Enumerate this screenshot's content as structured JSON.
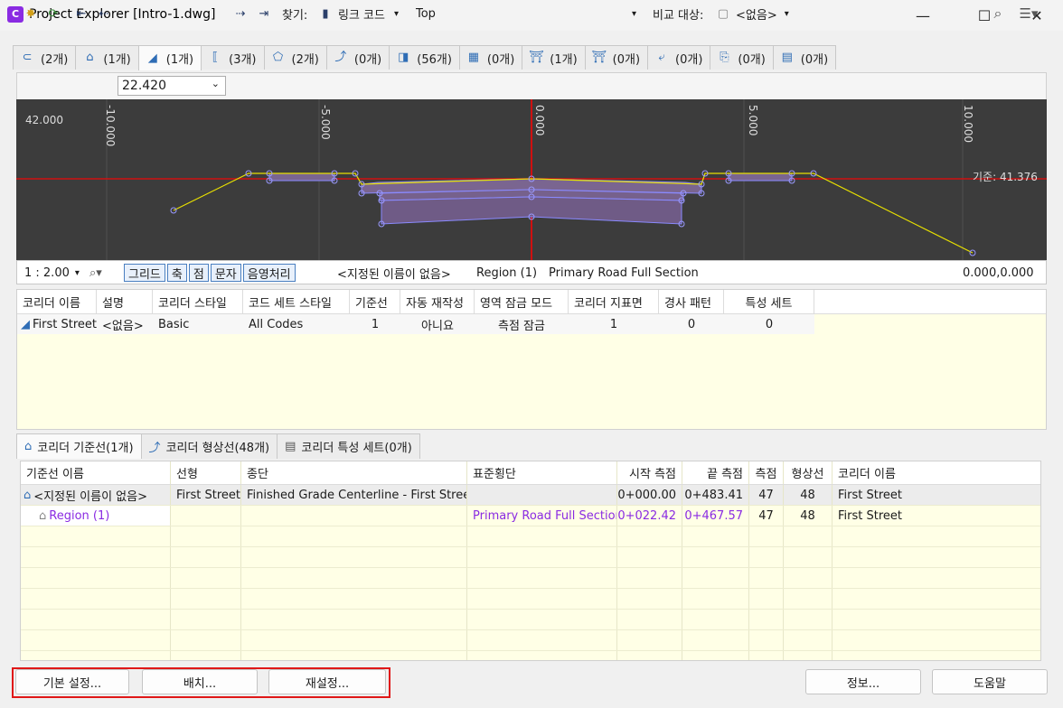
{
  "window": {
    "app_icon": "C",
    "title": "Project Explorer [Intro-1.dwg]",
    "minimize": "—",
    "maximize": "☐",
    "close": "✕"
  },
  "tabs": [
    {
      "icon": "alignment-icon",
      "glyph": "⊂",
      "label": "(2개)"
    },
    {
      "icon": "baseline-icon",
      "glyph": "⌂",
      "label": "(1개)"
    },
    {
      "icon": "corridor-icon",
      "glyph": "◢",
      "label": "(1개)"
    },
    {
      "icon": "assembly-icon",
      "glyph": "⟦",
      "label": "(3개)"
    },
    {
      "icon": "surface-icon",
      "glyph": "⬠",
      "label": "(2개)"
    },
    {
      "icon": "featureline-icon",
      "glyph": "⤴",
      "label": "(0개)"
    },
    {
      "icon": "subassembly-icon",
      "glyph": "◨",
      "label": "(56개)"
    },
    {
      "icon": "parcel-icon",
      "glyph": "▦",
      "label": "(0개)"
    },
    {
      "icon": "pipe-icon",
      "glyph": "⛩",
      "label": "(1개)"
    },
    {
      "icon": "pressure-icon",
      "glyph": "⛩",
      "label": "(0개)"
    },
    {
      "icon": "sample-icon",
      "glyph": "⤶",
      "label": "(0개)"
    },
    {
      "icon": "view-icon",
      "glyph": "⎘",
      "label": "(0개)"
    },
    {
      "icon": "sheet-icon",
      "glyph": "▤",
      "label": "(0개)"
    }
  ],
  "toolbar": {
    "station": "22.420",
    "find_label": "찾기:",
    "link_code": "링크 코드",
    "top_value": "Top",
    "compare_label": "비교 대상:",
    "compare_value": "<없음>"
  },
  "section_view": {
    "elevation_label": "42.000",
    "ticks": [
      "-10.000",
      "-5.000",
      "0.000",
      "5.000",
      "10.000"
    ],
    "datum_label": "기준: 41.376"
  },
  "viewbar": {
    "scale": "1 : 2.00",
    "toggles": [
      "그리드",
      "축",
      "점",
      "문자",
      "음영처리"
    ],
    "baseline_name": "<지정된 이름이 없음>",
    "region": "Region (1)",
    "assembly": "Primary Road Full Section",
    "coords": "0.000,0.000"
  },
  "corridor_table": {
    "headers": [
      "코리더 이름",
      "설명",
      "코리더 스타일",
      "코드 세트 스타일",
      "기준선",
      "자동 재작성",
      "영역 잠금 모드",
      "코리더 지표면",
      "경사 패턴",
      "특성 세트"
    ],
    "row": [
      "First Street",
      "<없음>",
      "Basic",
      "All Codes",
      "1",
      "아니요",
      "측점 잠금",
      "1",
      "0",
      "0"
    ]
  },
  "bottom_tabs": [
    "코리더 기준선(1개)",
    "코리더 형상선(48개)",
    "코리더 특성 세트(0개)"
  ],
  "baseline_table": {
    "headers": [
      "기준선 이름",
      "선형",
      "종단",
      "표준횡단",
      "시작 측점",
      "끝 측점",
      "측점",
      "형상선",
      "코리더 이름"
    ],
    "rows": [
      [
        "<지정된 이름이 없음>",
        "First Street",
        "Finished Grade Centerline - First Street",
        "",
        "0+000.00",
        "0+483.41",
        "47",
        "48",
        "First Street"
      ],
      [
        "Region (1)",
        "",
        "",
        "Primary Road Full Section",
        "0+022.42",
        "0+467.57",
        "47",
        "48",
        "First Street"
      ]
    ]
  },
  "buttons": {
    "settings": "기본 설정...",
    "layout": "배치...",
    "reset": "재설정...",
    "info": "정보...",
    "help": "도움말"
  },
  "colors": {
    "accent": "#8a2be2",
    "highlight": "#e01818",
    "canvas_bg": "#3c3c3c"
  }
}
